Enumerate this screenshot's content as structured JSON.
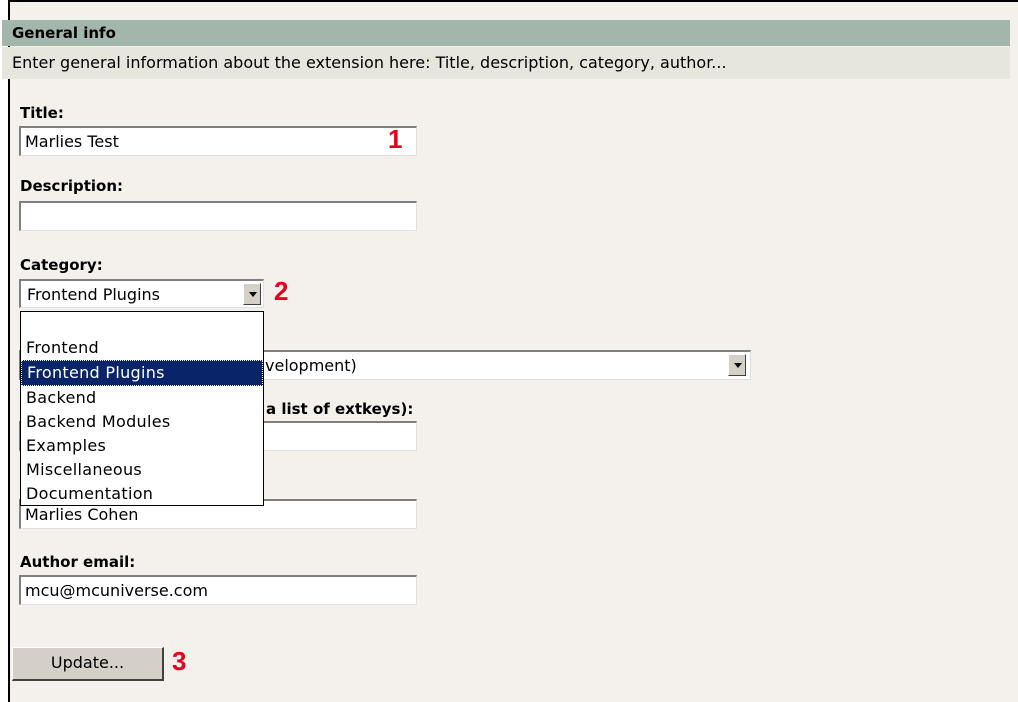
{
  "header": {
    "title": "General info"
  },
  "intro": "Enter general information about the extension here: Title, description, category, author...",
  "title_field": {
    "label": "Title:",
    "value": "Marlies Test"
  },
  "description_field": {
    "label": "Description:",
    "value": ""
  },
  "category_field": {
    "label": "Category:",
    "selected": "Frontend Plugins",
    "options": [
      "",
      "Frontend",
      "Frontend Plugins",
      "Backend",
      "Backend Modules",
      "Examples",
      "Miscellaneous",
      "Documentation"
    ]
  },
  "state_field": {
    "value_partial": "velopment)"
  },
  "dependencies_field": {
    "label_partial": "a list of extkeys):",
    "value": ""
  },
  "author_field": {
    "value": "Marlies Cohen"
  },
  "author_email_field": {
    "label": "Author email:",
    "value": "mcu@mcuniverse.com"
  },
  "update_button": {
    "label": "Update..."
  },
  "callouts": {
    "one": "1",
    "two": "2",
    "three": "3"
  },
  "colors": {
    "header_bg": "#a3b6ab",
    "selection": "#0a246a",
    "callout": "#e8001c"
  }
}
